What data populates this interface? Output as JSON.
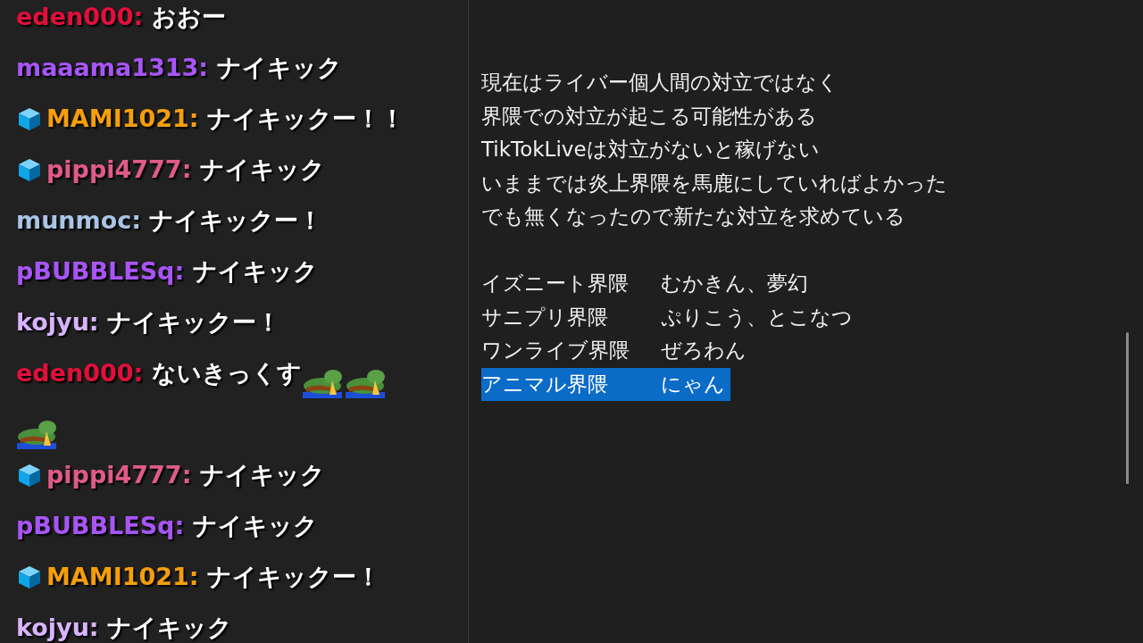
{
  "chat": [
    {
      "user": "eden000:",
      "color": "#e0103a",
      "badge": false,
      "text": "おおー"
    },
    {
      "user": "maaama1313:",
      "color": "#a855f7",
      "badge": false,
      "text": "ナイキック"
    },
    {
      "user": "MAMI1021:",
      "color": "#f59e0b",
      "badge": true,
      "text": "ナイキックー！！"
    },
    {
      "user": "pippi4777:",
      "color": "#e05a8a",
      "badge": true,
      "text": "ナイキック"
    },
    {
      "user": "munmoc:",
      "color": "#a9c4e4",
      "badge": false,
      "text": "ナイキックー！"
    },
    {
      "user": "pBUBBLESq:",
      "color": "#a855f7",
      "badge": false,
      "text": "ナイキック"
    },
    {
      "user": "kojyu:",
      "color": "#d8b4fe",
      "badge": false,
      "text": "ナイキックー！"
    },
    {
      "user": "eden000:",
      "color": "#e0103a",
      "badge": false,
      "text": "ないきっくす",
      "emotes": [
        {
          "kind": "frog"
        },
        {
          "kind": "frog"
        },
        {
          "kind": "frog"
        }
      ]
    },
    {
      "user": "pippi4777:",
      "color": "#e05a8a",
      "badge": true,
      "text": "ナイキック"
    },
    {
      "user": "pBUBBLESq:",
      "color": "#a855f7",
      "badge": false,
      "text": "ナイキック"
    },
    {
      "user": "MAMI1021:",
      "color": "#f59e0b",
      "badge": true,
      "text": "ナイキックー！"
    },
    {
      "user": "kojyu:",
      "color": "#d8b4fe",
      "badge": false,
      "text": "ナイキック"
    }
  ],
  "notes": {
    "lines": [
      "現在はライバー個人間の対立ではなく",
      "界隈での対立が起こる可能性がある",
      "TikTokLiveは対立がないと稼げない",
      "いままでは炎上界隈を馬鹿にしていればよかった",
      "でも無くなったので新たな対立を求めている"
    ],
    "groups": [
      {
        "label": "イズニート界隈",
        "members": "むかきん、夢幻",
        "selected": false
      },
      {
        "label": "サニプリ界隈",
        "members": "ぷりこう、とこなつ",
        "selected": false
      },
      {
        "label": "ワンライブ界隈",
        "members": "ぜろわん",
        "selected": false
      },
      {
        "label": "アニマル界隈",
        "members": "にゃん",
        "selected": true
      }
    ]
  }
}
